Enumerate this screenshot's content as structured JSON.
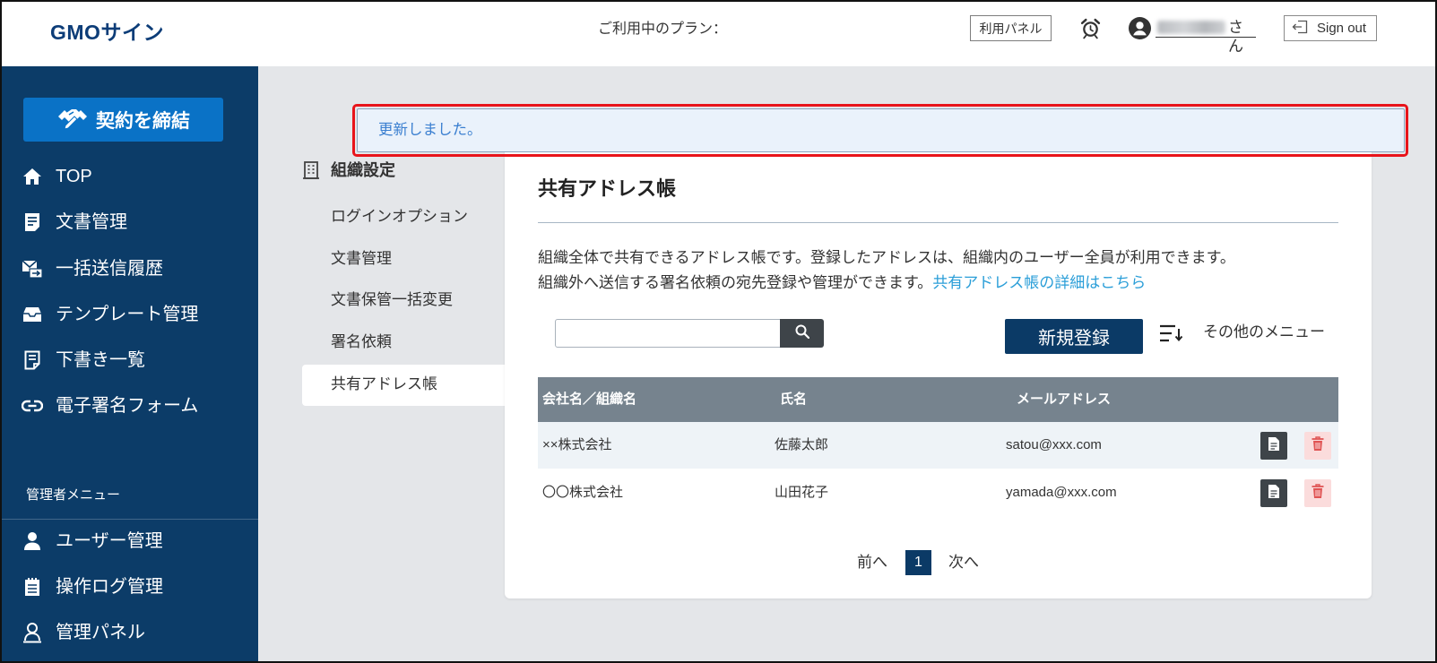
{
  "header": {
    "logo": "GMOサイン",
    "plan_label": "ご利用中のプラン：",
    "panel_button": "利用パネル",
    "alarm_icon": "alarm-clock-icon",
    "user_icon": "user-circle-icon",
    "user_suffix": "さん",
    "signout_label": "Sign out",
    "signout_icon": "sign-out-icon"
  },
  "sidebar": {
    "primary_button": {
      "label": "契約を締結",
      "icon": "handshake-icon"
    },
    "items": [
      {
        "label": "TOP",
        "icon": "home-icon"
      },
      {
        "label": "文書管理",
        "icon": "document-icon"
      },
      {
        "label": "一括送信履歴",
        "icon": "bulk-send-icon"
      },
      {
        "label": "テンプレート管理",
        "icon": "template-icon"
      },
      {
        "label": "下書き一覧",
        "icon": "draft-icon"
      },
      {
        "label": "電子署名フォーム",
        "icon": "link-icon"
      }
    ],
    "admin_heading": "管理者メニュー",
    "admin_items": [
      {
        "label": "ユーザー管理",
        "icon": "user-icon"
      },
      {
        "label": "操作ログ管理",
        "icon": "log-icon"
      },
      {
        "label": "管理パネル",
        "icon": "admin-panel-icon"
      }
    ]
  },
  "alert": {
    "message": "更新しました。"
  },
  "subnav": {
    "heading": "組織設定",
    "heading_icon": "building-icon",
    "items": [
      "ログインオプション",
      "文書管理",
      "文書保管一括変更",
      "署名依頼",
      "共有アドレス帳"
    ],
    "active": "共有アドレス帳"
  },
  "main": {
    "title": "共有アドレス帳",
    "description_line1": "組織全体で共有できるアドレス帳です。登録したアドレスは、組織内のユーザー全員が利用できます。",
    "description_line2": "組織外へ送信する署名依頼の宛先登録や管理ができます。",
    "description_link": "共有アドレス帳の詳細はこちら",
    "search_icon": "search-icon",
    "new_button": "新規登録",
    "other_menu": "その他のメニュー",
    "other_menu_icon": "sort-menu-icon",
    "table": {
      "columns": [
        "会社名／組織名",
        "氏名",
        "メールアドレス"
      ],
      "rows": [
        {
          "company": "××株式会社",
          "name": "佐藤太郎",
          "email": "satou@xxx.com"
        },
        {
          "company": "〇〇株式会社",
          "name": "山田花子",
          "email": "yamada@xxx.com"
        }
      ],
      "row_actions": [
        "document-icon",
        "trash-icon"
      ]
    },
    "pagination": {
      "prev": "前へ",
      "current": "1",
      "next": "次へ"
    }
  },
  "colors": {
    "brand": "#0d3d78",
    "sidebar": "#0c3c68",
    "primary": "#0a72c6",
    "navy": "#0b3a66",
    "link": "#2a9ed8",
    "table_head": "#76838e",
    "main_bg": "#e4e6e9",
    "highlight": "#e8141b"
  }
}
